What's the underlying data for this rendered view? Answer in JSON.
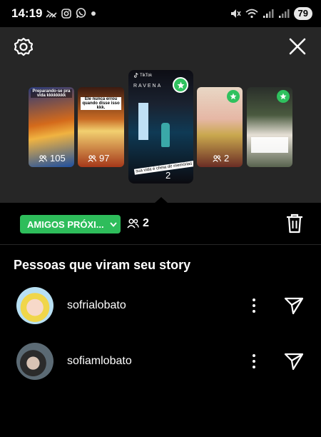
{
  "status": {
    "time": "14:19",
    "battery": "79",
    "left_icons": [
      "signal-slash-icon",
      "instagram-icon",
      "whatsapp-icon",
      "dot-icon"
    ],
    "right_icons": [
      "mute-icon",
      "wifi-icon",
      "cell-signal-icon",
      "cell-signal-icon"
    ]
  },
  "header": {
    "settings_icon": "gear-icon",
    "close_icon": "close-icon"
  },
  "stories": [
    {
      "caption": "Preparando-se pra vida kkkkkkkk",
      "views": "105",
      "selected": false,
      "close_friends": false
    },
    {
      "caption": "Ele nunca errou quando disse isso kkk.",
      "views": "97",
      "selected": false,
      "close_friends": false
    },
    {
      "caption": "RAVENA",
      "views": "2",
      "selected": true,
      "close_friends": true,
      "app_label": "TikTok",
      "bottom_text": "sua vida é cheia de memórias"
    },
    {
      "caption": "",
      "views": "2",
      "selected": false,
      "close_friends": true
    },
    {
      "caption": "",
      "views": "",
      "selected": false,
      "close_friends": true
    }
  ],
  "audience": {
    "badge_label": "AMIGOS PRÓXI...",
    "viewer_count": "2"
  },
  "viewers_section": {
    "title": "Pessoas que viram seu story",
    "viewers": [
      {
        "username": "sofrialobato"
      },
      {
        "username": "sofiamlobato"
      }
    ]
  },
  "colors": {
    "accent_green": "#2ebd5b",
    "panel": "#262626",
    "background": "#000000"
  }
}
